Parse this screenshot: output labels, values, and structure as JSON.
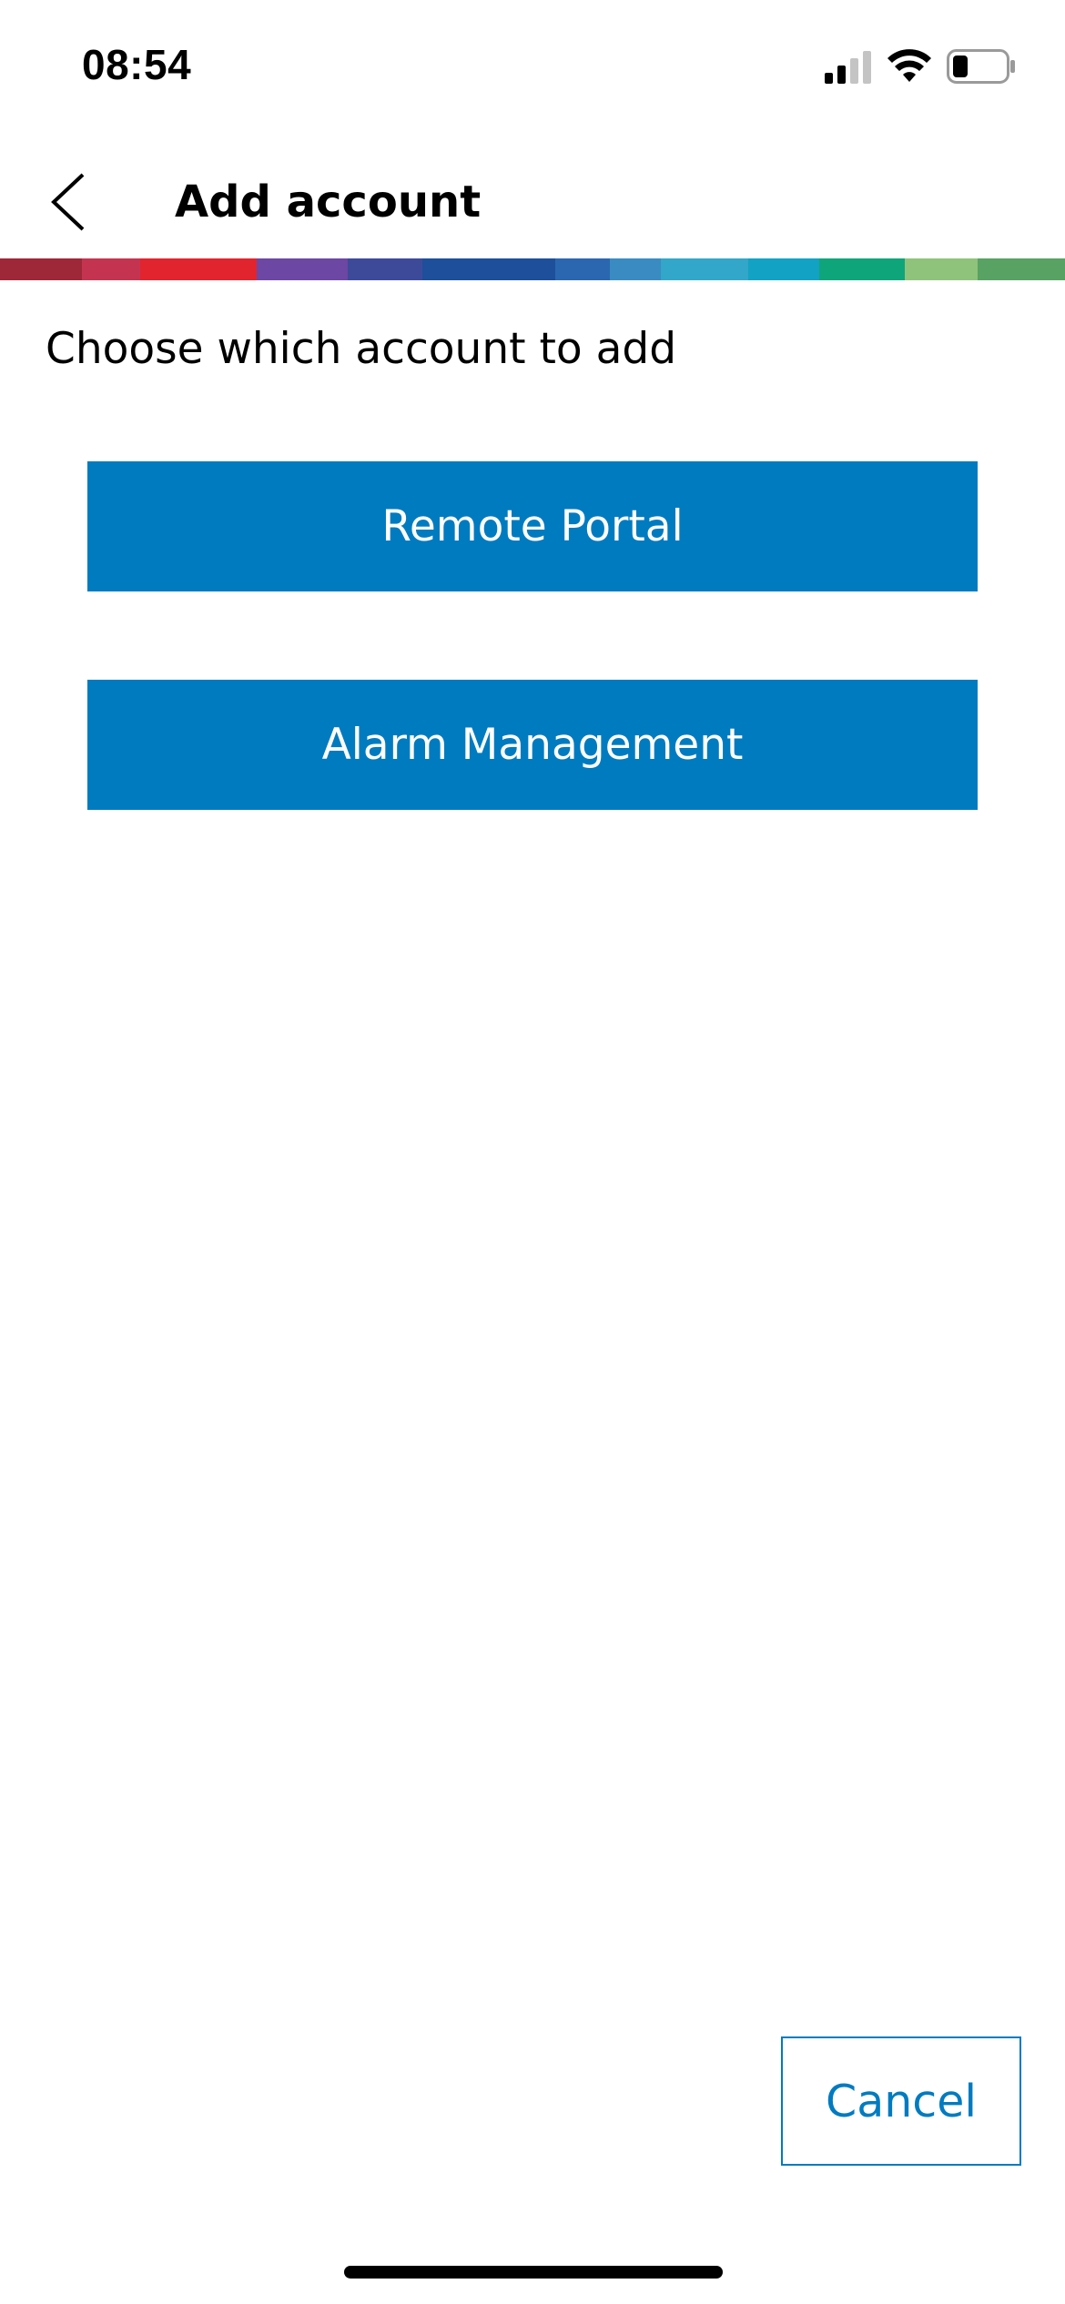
{
  "status_bar": {
    "time": "08:54",
    "icons": [
      "signal-icon",
      "wifi-icon",
      "battery-icon"
    ]
  },
  "header": {
    "back_icon": "chevron-left-icon",
    "title": "Add account"
  },
  "brand_bar": {
    "colors": [
      "#9e2738",
      "#c43450",
      "#e2242f",
      "#6c47a3",
      "#3d4a9a",
      "#1d4f9a",
      "#2a67b0",
      "#3a8bc2",
      "#32a7c9",
      "#12a2c4",
      "#0fa57a",
      "#8fc37b",
      "#58a263"
    ]
  },
  "content": {
    "prompt": "Choose which account to add",
    "buttons": {
      "remote_portal": "Remote Portal",
      "alarm_management": "Alarm Management"
    },
    "cancel": "Cancel"
  },
  "colors": {
    "primary": "#007bc0",
    "background": "#ffffff",
    "text": "#000000"
  }
}
